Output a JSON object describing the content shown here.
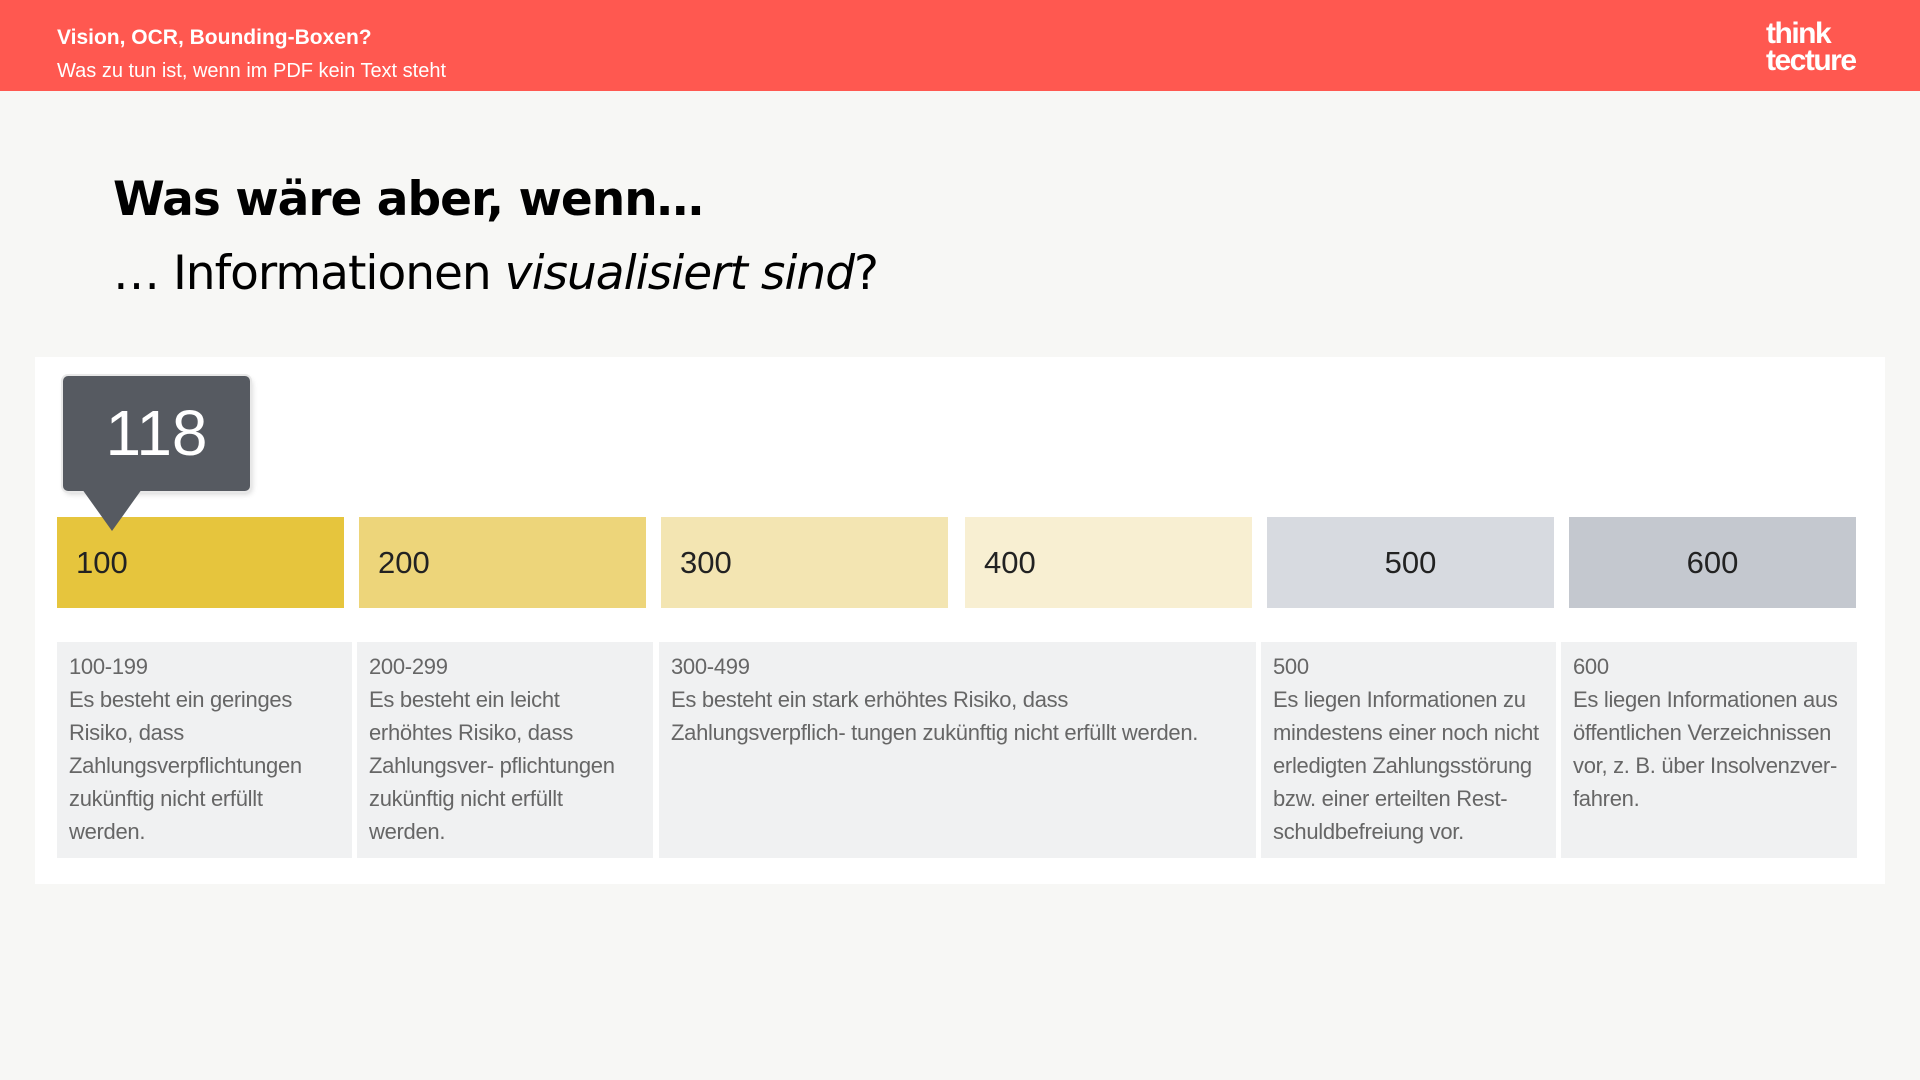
{
  "header": {
    "title": "Vision, OCR, Bounding-Boxen?",
    "subtitle": "Was zu tun ist, wenn im PDF kein Text steht",
    "logo_line1": "think",
    "logo_line2": "tecture"
  },
  "slide": {
    "heading": "Was wäre aber, wenn…",
    "sub_prefix": "… Informationen ",
    "sub_italic": "visualisiert sind",
    "sub_suffix": "?"
  },
  "score": {
    "value": "118"
  },
  "bands": [
    {
      "label": "100",
      "color": "#e6c53d"
    },
    {
      "label": "200",
      "color": "#edd57a"
    },
    {
      "label": "300",
      "color": "#f3e5b2"
    },
    {
      "label": "400",
      "color": "#f8efd2"
    },
    {
      "label": "500",
      "color": "#d7dae0"
    },
    {
      "label": "600",
      "color": "#c4c8cf"
    }
  ],
  "descriptions": [
    {
      "range": "100-199",
      "text": "Es besteht ein geringes Risiko, dass Zahlungsverpflichtungen zukünftig nicht erfüllt werden."
    },
    {
      "range": "200-299",
      "text": "Es besteht ein leicht erhöhtes Risiko, dass Zahlungsver- pflichtungen zukünftig nicht erfüllt werden."
    },
    {
      "range": "300-499",
      "text": "Es besteht ein stark erhöhtes Risiko, dass Zahlungsverpflich- tungen zukünftig nicht erfüllt werden."
    },
    {
      "range": "500",
      "text": "Es liegen Informationen zu mindestens einer noch nicht erledigten Zahlungsstörung bzw. einer erteilten Rest- schuldbefreiung vor."
    },
    {
      "range": "600",
      "text": "Es liegen Informationen aus öffentlichen Verzeichnissen vor, z. B. über Insolvenzver- fahren."
    }
  ]
}
